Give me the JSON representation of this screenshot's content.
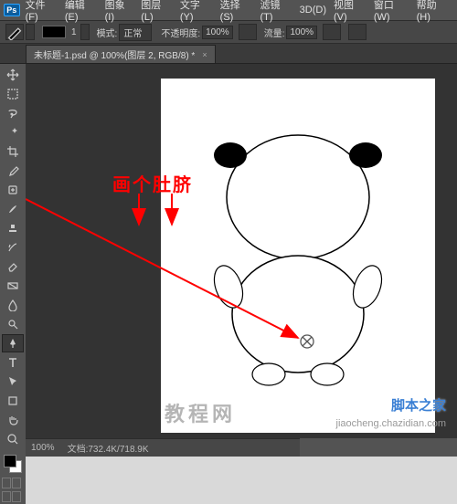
{
  "logo": "Ps",
  "menu": [
    "文件(F)",
    "编辑(E)",
    "图象(I)",
    "图层(L)",
    "文字(Y)",
    "选择(S)",
    "滤镜(T)",
    "3D(D)",
    "视图(V)",
    "窗口(W)",
    "帮助(H)"
  ],
  "options": {
    "brush_size": "1",
    "mode_label": "模式:",
    "mode_value": "正常",
    "opacity_label": "不透明度:",
    "opacity_value": "100%",
    "flow_label": "流量:",
    "flow_value": "100%"
  },
  "tab": {
    "title": "未标题-1.psd @ 100%(图层 2, RGB/8) *",
    "close": "×"
  },
  "tools": [
    "move",
    "marquee",
    "lasso",
    "wand",
    "crop",
    "eyedropper",
    "heal",
    "brush",
    "stamp",
    "history-brush",
    "eraser",
    "gradient",
    "blur",
    "dodge",
    "pen",
    "type",
    "path-select",
    "rectangle",
    "hand",
    "zoom"
  ],
  "colors": {
    "fg": "#000000",
    "bg": "#ffffff"
  },
  "annotation": "画个肚脐",
  "status": {
    "zoom": "100%",
    "info": "文档:732.4K/718.9K"
  },
  "watermarks": {
    "brand": "脚本之家",
    "url": "jiaocheng.chazidian.com",
    "faded": "教程网"
  }
}
